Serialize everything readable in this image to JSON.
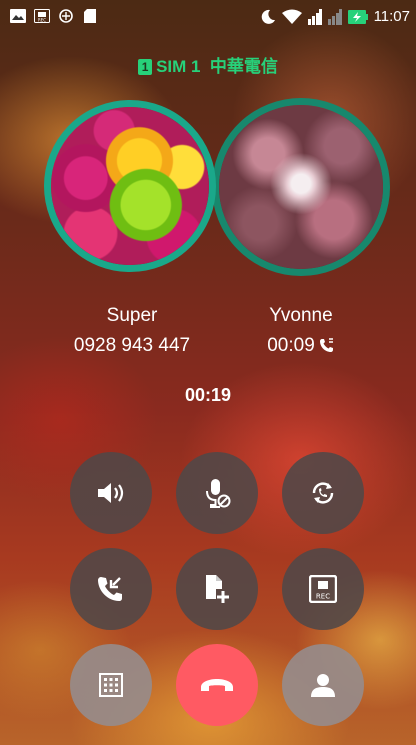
{
  "status": {
    "time": "11:07",
    "rec_icon_label": "REC"
  },
  "sim": {
    "badge": "1",
    "label": "SIM 1  中華電信"
  },
  "callers": [
    {
      "name": "Super",
      "detail": "0928 943 447"
    },
    {
      "name": "Yvonne",
      "detail": "00:09"
    }
  ],
  "call_timer": "00:19",
  "buttons": {
    "rec_label": "REC"
  },
  "colors": {
    "accent_green": "#27d17a",
    "avatar_ring": "#1aa88a",
    "end_call": "#ff5a63",
    "button_bg": "#504848"
  },
  "icons": {
    "speaker": "speaker-icon",
    "mute": "mic-muted-icon",
    "swap": "swap-calls-icon",
    "merge": "merge-call-icon",
    "add_call": "add-call-icon",
    "record": "record-icon",
    "dialpad": "dialpad-icon",
    "end_call": "end-call-icon",
    "contacts": "contacts-icon"
  }
}
